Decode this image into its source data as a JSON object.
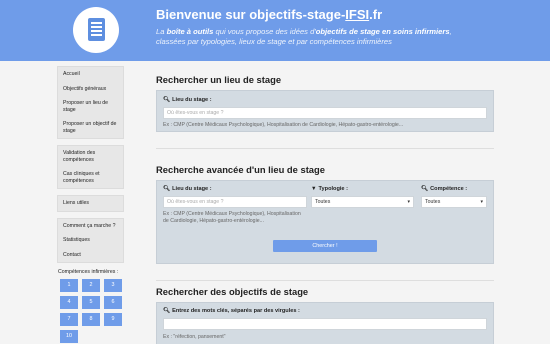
{
  "header": {
    "title_prefix": "Bienvenue sur objectifs-stage-",
    "title_brand": "IFSI",
    "title_suffix": ".fr",
    "tagline_part1": "La ",
    "tagline_bold1": "boîte à outils",
    "tagline_part2": " qui vous propose des idées d'",
    "tagline_bold2": "objectifs de stage en soins infirmiers",
    "tagline_part3": ", classées par typologies, lieux de stage et par compétences infirmières"
  },
  "sidebar": {
    "group1": [
      "Accueil",
      "Objectifs généraux",
      "Proposer un lieu de stage",
      "Proposer un objectif de stage"
    ],
    "group2": [
      "Validation des compétences",
      "Cas cliniques et compétences"
    ],
    "group3": [
      "Liens utiles"
    ],
    "group4": [
      "Comment ça marche ?",
      "Statistiques",
      "Contact"
    ],
    "skills_title": "Compétences infirmières :",
    "skills": [
      "1",
      "2",
      "3",
      "4",
      "5",
      "6",
      "7",
      "8",
      "9",
      "10"
    ]
  },
  "section1": {
    "title": "Rechercher un lieu de stage",
    "label": "Lieu du stage :",
    "placeholder": "Où êtes-vous en stage ?",
    "hint": "Ex : CMP (Centre Médicaux Psychologique), Hospitalisation de Cardiologie, Hépato-gastro-entérologie..."
  },
  "section2": {
    "title": "Recherche avancée d'un lieu de stage",
    "label_place": "Lieu du stage :",
    "placeholder": "Où êtes-vous en stage ?",
    "hint": "Ex : CMP (Centre Médicaux Psychologique), Hospitalisation de Cardiologie, Hépato-gastro-entérologie...",
    "label_type": "Typologie :",
    "type_value": "Toutes",
    "label_skill": "Compétence :",
    "skill_value": "Toutes",
    "button": "Chercher !"
  },
  "section3": {
    "title": "Rechercher des objectifs de stage",
    "label": "Entrez des mots clés, séparés par des virgules :",
    "hint": "Ex : \"réfection, pansement\""
  },
  "colors": {
    "accent": "#6f9ce9",
    "panel": "#d3dbe2"
  }
}
